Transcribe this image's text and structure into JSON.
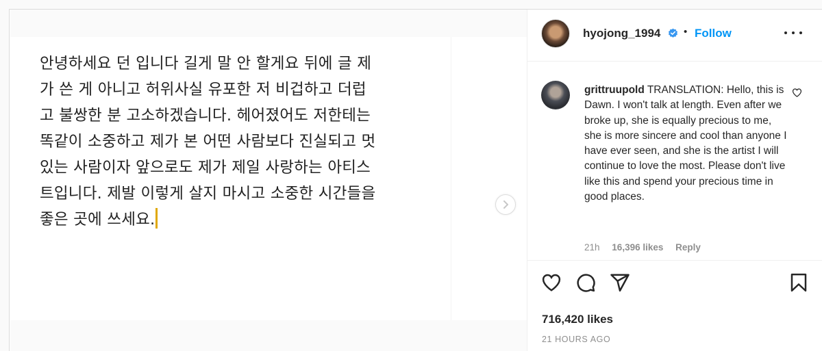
{
  "post": {
    "image_text": "안녕하세요 던 입니다 길게 말 안 할게요 뒤에 글 제\n가 쓴 게 아니고 허위사실 유포한 저 비겁하고 더럽\n고 불쌍한 분 고소하겠습니다. 헤어졌어도 저한테는\n똑같이 소중하고 제가 본 어떤 사람보다 진실되고 멋\n있는 사람이자 앞으로도 제가 제일 사랑하는 아티스\n트입니다. 제발 이렇게 살지 마시고 소중한 시간들을\n좋은 곳에 쓰세요.",
    "next_icon": "chevron-right-icon"
  },
  "header": {
    "username": "hyojong_1994",
    "separator": "•",
    "follow_label": "Follow",
    "verified_icon": "verified-badge-icon",
    "more_icon": "more-options-icon"
  },
  "comment": {
    "username": "grittruupold",
    "text": "TRANSLATION: Hello, this is Dawn. I won't talk at length. Even after we broke up, she is equally precious to me, she is more sincere and cool than anyone I have ever seen, and she is the artist I will continue to love the most. Please don't live like this and spend your precious time in good places.",
    "time": "21h",
    "likes": "16,396 likes",
    "reply_label": "Reply"
  },
  "actions": {
    "like_icon": "heart-icon",
    "comment_icon": "comment-icon",
    "share_icon": "send-icon",
    "save_icon": "bookmark-icon"
  },
  "likes_count": "716,420 likes",
  "posted_ago": "21 HOURS AGO",
  "colors": {
    "link_blue": "#0095f6",
    "text": "#262626",
    "muted": "#8e8e8e",
    "border": "#dbdbdb",
    "cursor": "#e0a800"
  }
}
